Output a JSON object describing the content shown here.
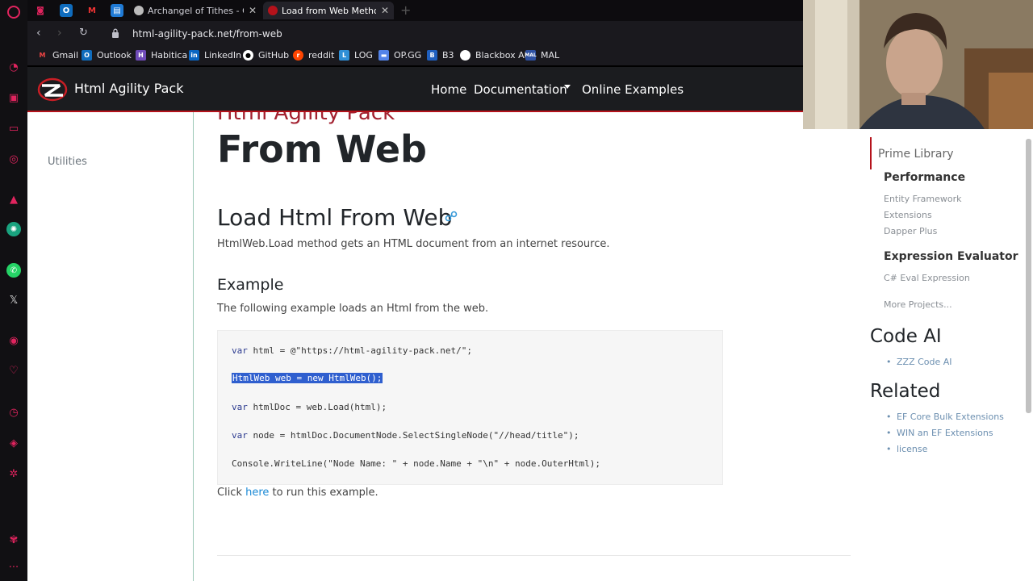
{
  "tabs": {
    "archangel_title": "Archangel of Tithes - Outla",
    "active_title": "Load from Web Method in"
  },
  "address": {
    "url": "html-agility-pack.net/from-web"
  },
  "bookmarks": [
    "Gmail",
    "Outlook",
    "Habitica",
    "LinkedIn",
    "GitHub",
    "reddit",
    "LOG",
    "OP.GG",
    "B3",
    "Blackbox AI",
    "MAL"
  ],
  "site": {
    "brand": "Html Agility Pack",
    "nav": {
      "home": "Home",
      "documentation": "Documentation",
      "online_examples": "Online Examples"
    }
  },
  "left": {
    "utilities": "Utilities"
  },
  "main": {
    "eyebrow": "Html Agility Pack",
    "h1": "From Web",
    "h2": "Load Html From Web",
    "description": "HtmlWeb.Load method gets an HTML document from an internet resource.",
    "example_heading": "Example",
    "example_description": "The following example loads an Html from the web.",
    "code": {
      "line1_kw": "var",
      "line1_rest": " html = @\"https://html-agility-pack.net/\";",
      "line2": "HtmlWeb web = new HtmlWeb();",
      "line3_kw": "var",
      "line3_rest": " htmlDoc = web.Load(html);",
      "line4_kw": "var",
      "line4_rest": " node = htmlDoc.DocumentNode.SelectSingleNode(\"//head/title\");",
      "line5": "Console.WriteLine(\"Node Name: \" + node.Name + \"\\n\" + node.OuterHtml);"
    },
    "run_prefix": "Click ",
    "run_link": "here",
    "run_suffix": " to run this example."
  },
  "right": {
    "prime_library": "Prime Library",
    "performance": "Performance",
    "performance_links": [
      "Entity Framework",
      "Extensions",
      "Dapper Plus"
    ],
    "expression_evaluator": "Expression Evaluator",
    "eval_link": "C# Eval Expression",
    "more_projects": "More Projects...",
    "code_ai": "Code AI",
    "code_ai_links": [
      "ZZZ Code AI"
    ],
    "related": "Related",
    "related_links": [
      "EF Core Bulk Extensions",
      "WIN an EF Extensions",
      "license"
    ]
  },
  "colors": {
    "accent": "#b5121b",
    "nav_bg": "#1b1c1f",
    "link": "#1b8ad6",
    "selection": "#2f5fcf"
  }
}
